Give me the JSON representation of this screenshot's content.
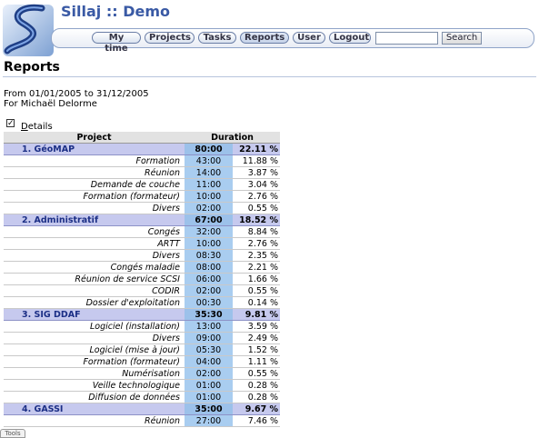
{
  "header": {
    "app_title": "Sillaj :: Demo",
    "nav": [
      {
        "label": "My time",
        "active": false
      },
      {
        "label": "Projects",
        "active": false
      },
      {
        "label": "Tasks",
        "active": false
      },
      {
        "label": "Reports",
        "active": true
      },
      {
        "label": "User",
        "active": false
      },
      {
        "label": "Logout",
        "active": false
      }
    ],
    "search_value": "",
    "search_button": "Search",
    "colors": {
      "title": "#3a5aa5",
      "project_row": "#c6c9ee",
      "duration_cell": "#a9cdf0"
    }
  },
  "page": {
    "title": "Reports",
    "period": "From 01/01/2005 to 31/12/2005",
    "for_user": "For Michaël Delorme",
    "details_checked": true,
    "details_label": "Details"
  },
  "table": {
    "headers": {
      "project": "Project",
      "duration": "Duration"
    },
    "rows": [
      {
        "kind": "project",
        "name": "1. GéoMAP",
        "duration": "80:00",
        "percent": "22.11 %"
      },
      {
        "kind": "task",
        "name": "Formation",
        "duration": "43:00",
        "percent": "11.88 %"
      },
      {
        "kind": "task",
        "name": "Réunion",
        "duration": "14:00",
        "percent": "3.87 %"
      },
      {
        "kind": "task",
        "name": "Demande de couche",
        "duration": "11:00",
        "percent": "3.04 %"
      },
      {
        "kind": "task",
        "name": "Formation (formateur)",
        "duration": "10:00",
        "percent": "2.76 %"
      },
      {
        "kind": "task",
        "name": "Divers",
        "duration": "02:00",
        "percent": "0.55 %"
      },
      {
        "kind": "project",
        "name": "2. Administratif",
        "duration": "67:00",
        "percent": "18.52 %"
      },
      {
        "kind": "task",
        "name": "Congés",
        "duration": "32:00",
        "percent": "8.84 %"
      },
      {
        "kind": "task",
        "name": "ARTT",
        "duration": "10:00",
        "percent": "2.76 %"
      },
      {
        "kind": "task",
        "name": "Divers",
        "duration": "08:30",
        "percent": "2.35 %"
      },
      {
        "kind": "task",
        "name": "Congés maladie",
        "duration": "08:00",
        "percent": "2.21 %"
      },
      {
        "kind": "task",
        "name": "Réunion de service SCSI",
        "duration": "06:00",
        "percent": "1.66 %"
      },
      {
        "kind": "task",
        "name": "CODIR",
        "duration": "02:00",
        "percent": "0.55 %"
      },
      {
        "kind": "task",
        "name": "Dossier d'exploitation",
        "duration": "00:30",
        "percent": "0.14 %"
      },
      {
        "kind": "project",
        "name": "3. SIG DDAF",
        "duration": "35:30",
        "percent": "9.81 %"
      },
      {
        "kind": "task",
        "name": "Logiciel (installation)",
        "duration": "13:00",
        "percent": "3.59 %"
      },
      {
        "kind": "task",
        "name": "Divers",
        "duration": "09:00",
        "percent": "2.49 %"
      },
      {
        "kind": "task",
        "name": "Logiciel (mise à jour)",
        "duration": "05:30",
        "percent": "1.52 %"
      },
      {
        "kind": "task",
        "name": "Formation (formateur)",
        "duration": "04:00",
        "percent": "1.11 %"
      },
      {
        "kind": "task",
        "name": "Numérisation",
        "duration": "02:00",
        "percent": "0.55 %"
      },
      {
        "kind": "task",
        "name": "Veille technologique",
        "duration": "01:00",
        "percent": "0.28 %"
      },
      {
        "kind": "task",
        "name": "Diffusion de données",
        "duration": "01:00",
        "percent": "0.28 %"
      },
      {
        "kind": "project",
        "name": "4. GASSI",
        "duration": "35:00",
        "percent": "9.67 %"
      },
      {
        "kind": "task",
        "name": "Réunion",
        "duration": "27:00",
        "percent": "7.46 %"
      }
    ]
  },
  "bottom_tab": "Tools"
}
